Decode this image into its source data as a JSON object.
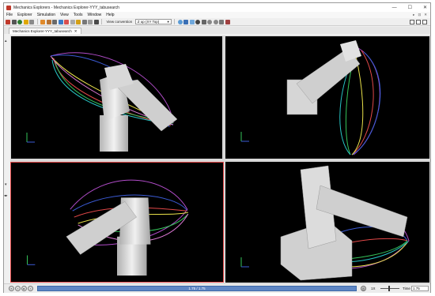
{
  "window": {
    "title": "Mechanics Explorers - Mechanics Explorer-YYY_tabusearch",
    "minimize_glyph": "—",
    "maximize_glyph": "☐",
    "close_glyph": "✕"
  },
  "menu": {
    "items": [
      "File",
      "Explorer",
      "Simulation",
      "View",
      "Tools",
      "Window",
      "Help"
    ]
  },
  "toolbar": {
    "view_convention_label": "View convention",
    "view_convention_value": "Z up (XY Top)"
  },
  "tab": {
    "label": "Mechanics Explorer-YYY_tabusearch",
    "close_glyph": "✕"
  },
  "playback": {
    "progress_text": "1.75 / 1.75",
    "progress_fraction": 1.0,
    "speed_value": "1X",
    "time_label": "Time",
    "time_value": "1.75"
  },
  "colors": {
    "viewport_bg": "#000000",
    "active_border": "#e34848",
    "progress_fill": "#5e86c4",
    "robot_body": "#d9d9d9"
  },
  "icons": {
    "app": "matlab-simscape-icon",
    "playback": [
      "rewind-icon",
      "step-back-icon",
      "play-icon",
      "step-forward-icon"
    ],
    "speed": "speed-icon"
  }
}
